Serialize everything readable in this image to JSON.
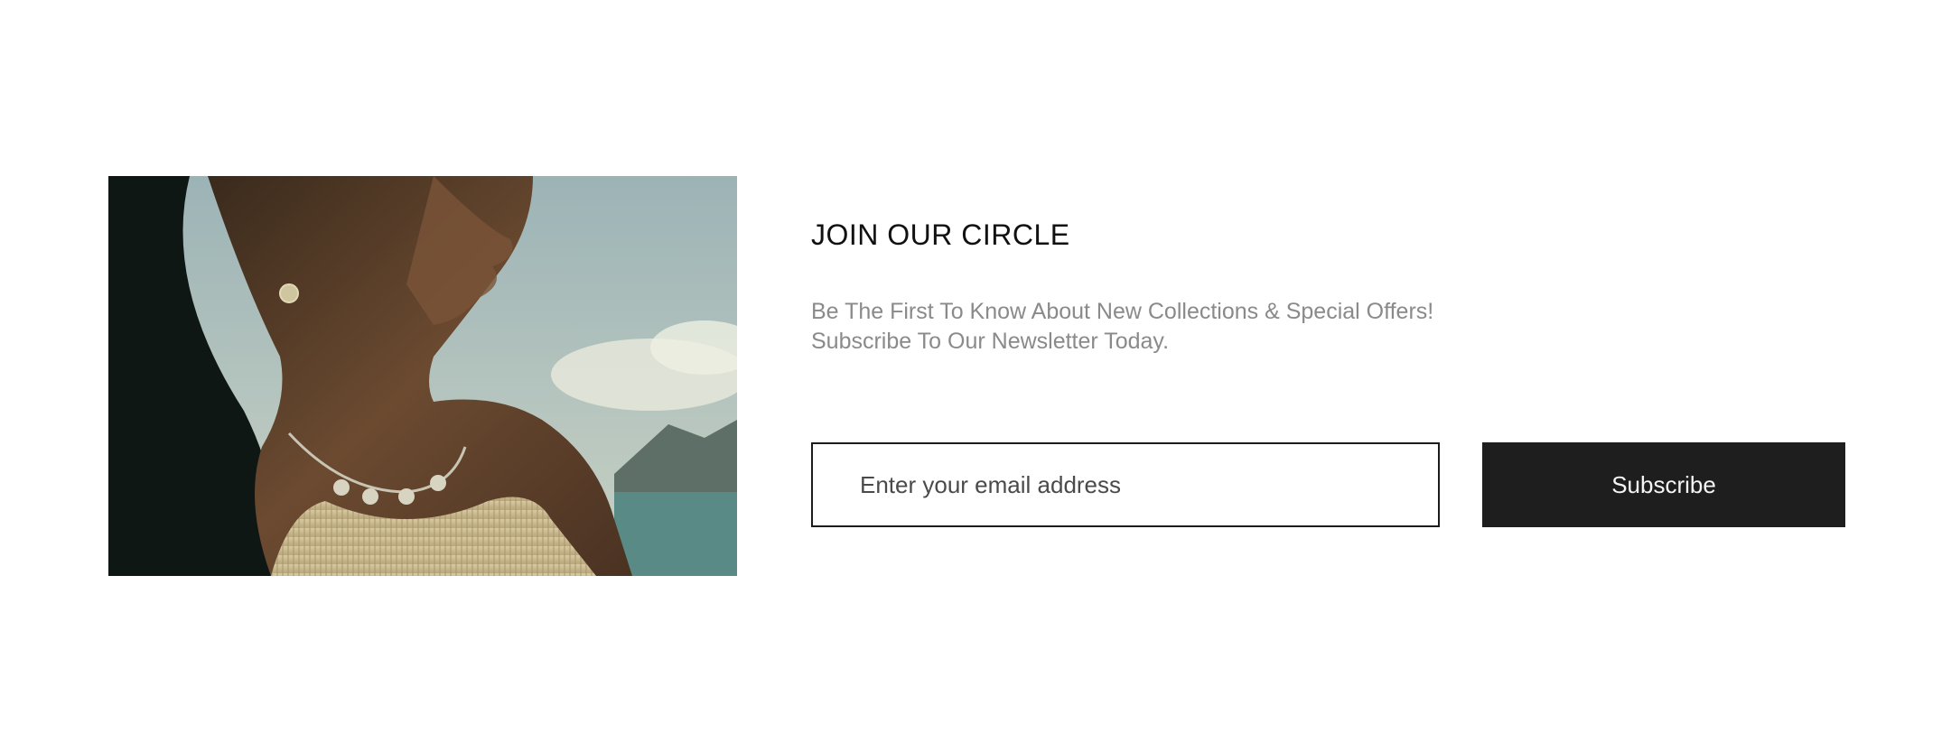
{
  "newsletter": {
    "heading": "JOIN OUR CIRCLE",
    "subtext_line1": "Be The First To Know About New Collections & Special Offers!",
    "subtext_line2": "Subscribe To Our Newsletter Today.",
    "email_placeholder": "Enter your email address",
    "email_value": "",
    "subscribe_label": "Subscribe"
  },
  "image": {
    "subject": "woman wearing necklace and sun earring",
    "icon": "hero-photo"
  },
  "colors": {
    "heading": "#111111",
    "subtext": "#8a8a8a",
    "button_bg": "#1e1e1e",
    "button_text": "#f5f5f5",
    "input_border": "#1c1c1c",
    "background": "#ffffff"
  }
}
